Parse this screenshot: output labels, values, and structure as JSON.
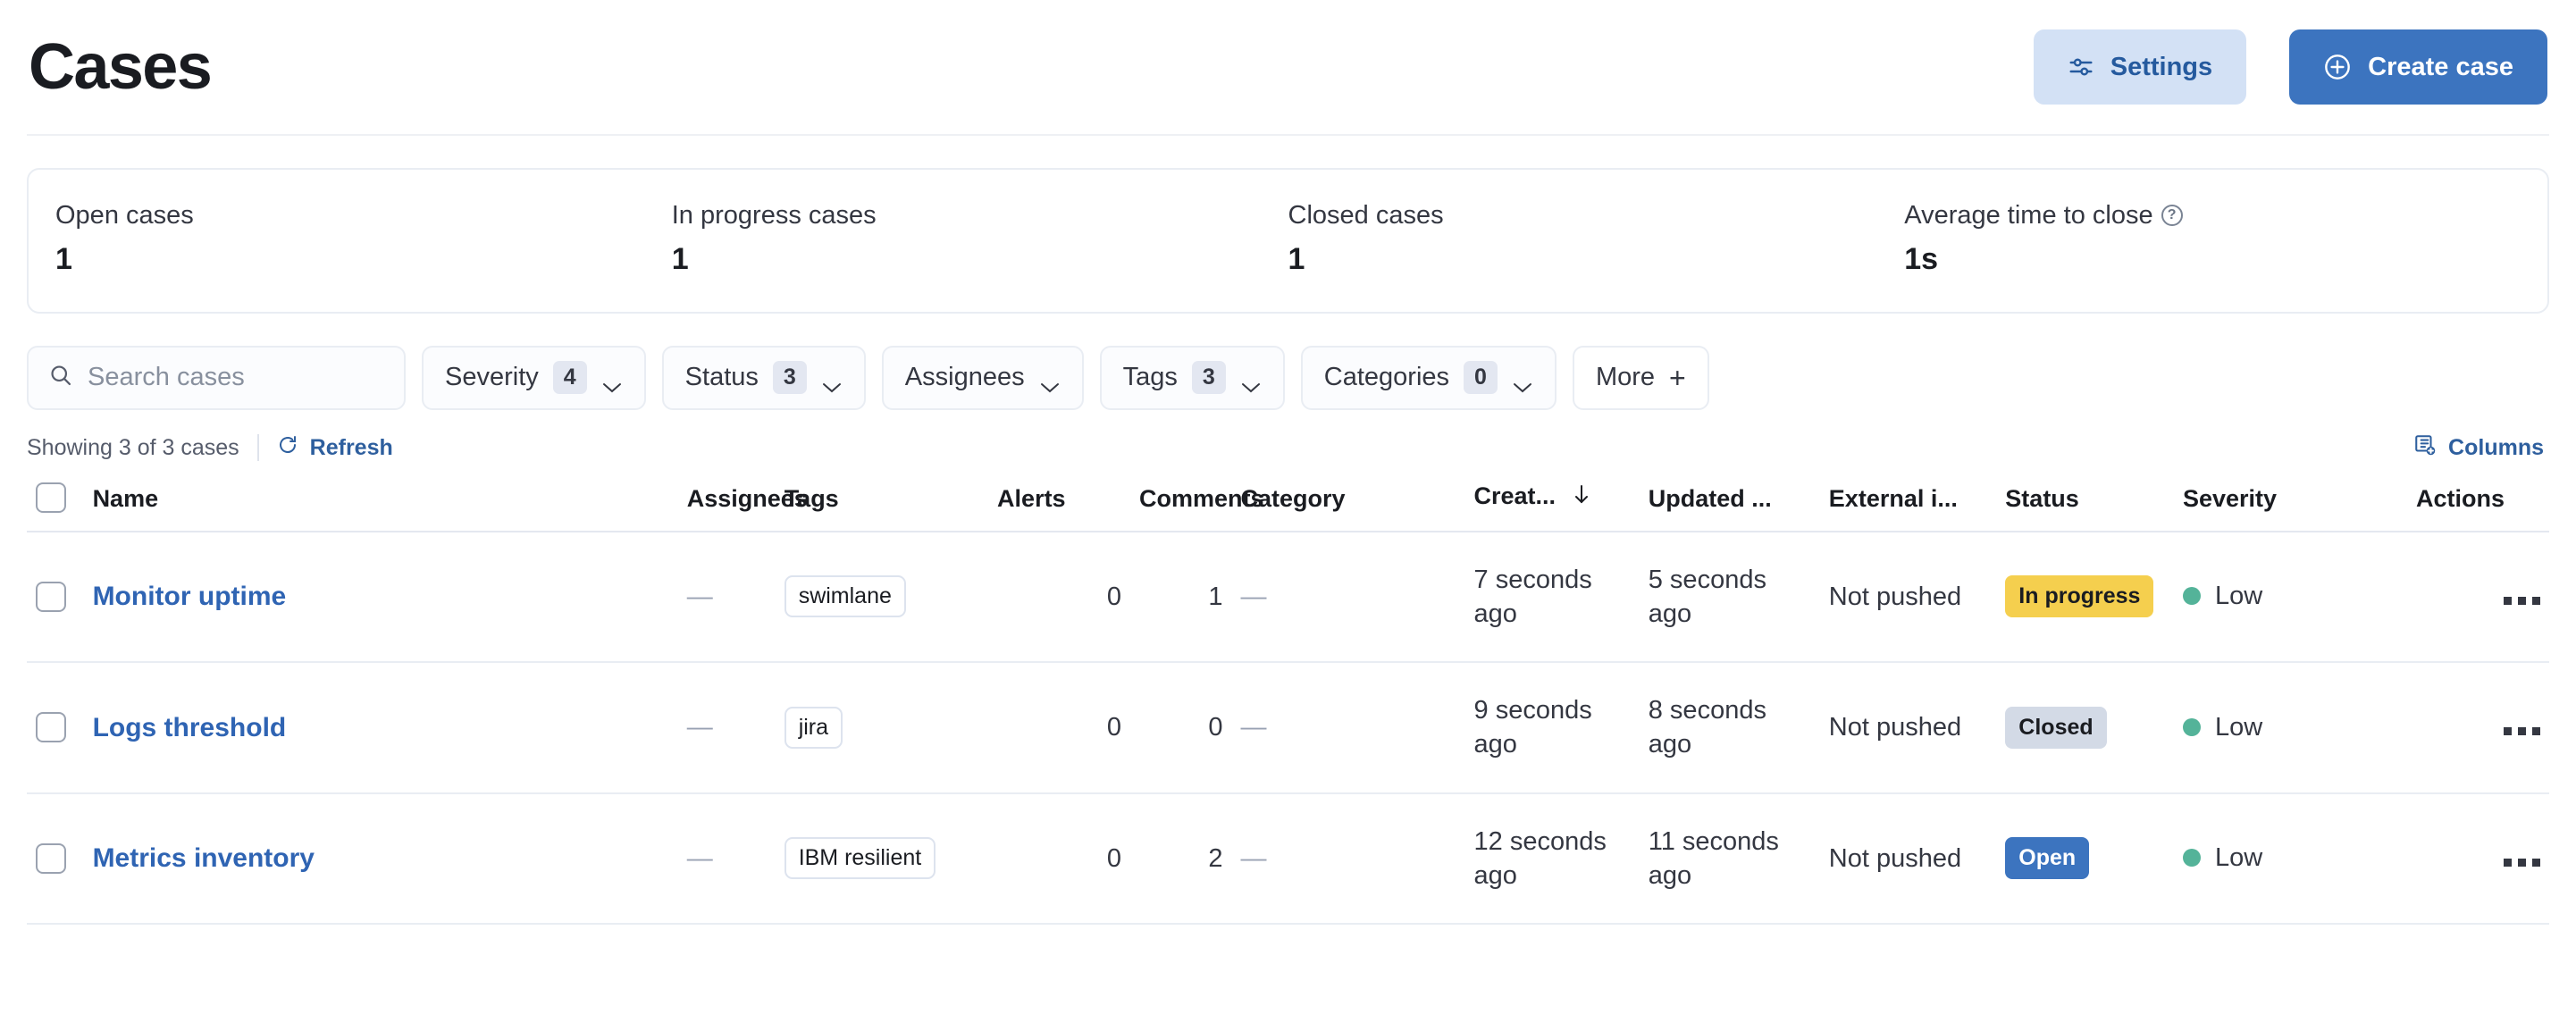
{
  "header": {
    "title": "Cases",
    "settings_label": "Settings",
    "create_label": "Create case"
  },
  "stats": [
    {
      "label": "Open cases",
      "value": "1",
      "has_help": false
    },
    {
      "label": "In progress cases",
      "value": "1",
      "has_help": false
    },
    {
      "label": "Closed cases",
      "value": "1",
      "has_help": false
    },
    {
      "label": "Average time to close",
      "value": "1s",
      "has_help": true
    }
  ],
  "filters": {
    "search_placeholder": "Search cases",
    "search_value": "",
    "buttons": [
      {
        "label": "Severity",
        "count": "4",
        "has_chevron": true
      },
      {
        "label": "Status",
        "count": "3",
        "has_chevron": true
      },
      {
        "label": "Assignees",
        "count": "",
        "has_chevron": true
      },
      {
        "label": "Tags",
        "count": "3",
        "has_chevron": true
      },
      {
        "label": "Categories",
        "count": "0",
        "has_chevron": true
      },
      {
        "label": "More",
        "count": "",
        "has_chevron": false
      }
    ]
  },
  "meta": {
    "showing": "Showing 3 of 3 cases",
    "refresh": "Refresh",
    "columns": "Columns"
  },
  "table": {
    "columns": [
      "Name",
      "Assignees",
      "Tags",
      "Alerts",
      "Comments",
      "Category",
      "Creat...",
      "Updated ...",
      "External i...",
      "Status",
      "Severity",
      "Actions"
    ],
    "sort_column": "Creat...",
    "sort_direction": "desc",
    "rows": [
      {
        "name": "Monitor uptime",
        "assignees": "—",
        "tags": [
          "swimlane"
        ],
        "alerts": "0",
        "comments": "1",
        "category": "—",
        "created": "7 seconds ago",
        "updated": "5 seconds ago",
        "external": "Not pushed",
        "status": "In progress",
        "status_bg": "#f5cf4e",
        "status_fg": "#1a1c21",
        "severity": "Low",
        "severity_color": "#54b399"
      },
      {
        "name": "Logs threshold",
        "assignees": "—",
        "tags": [
          "jira"
        ],
        "alerts": "0",
        "comments": "0",
        "category": "—",
        "created": "9 seconds ago",
        "updated": "8 seconds ago",
        "external": "Not pushed",
        "status": "Closed",
        "status_bg": "#d3dae6",
        "status_fg": "#1a1c21",
        "severity": "Low",
        "severity_color": "#54b399"
      },
      {
        "name": "Metrics inventory",
        "assignees": "—",
        "tags": [
          "IBM resilient"
        ],
        "alerts": "0",
        "comments": "2",
        "category": "—",
        "created": "12 seconds ago",
        "updated": "11 seconds ago",
        "external": "Not pushed",
        "status": "Open",
        "status_bg": "#3c74bf",
        "status_fg": "#ffffff",
        "severity": "Low",
        "severity_color": "#54b399"
      }
    ]
  },
  "colors": {
    "primary": "#3c74bf",
    "link": "#2f64b3",
    "border": "#e9edf3"
  }
}
